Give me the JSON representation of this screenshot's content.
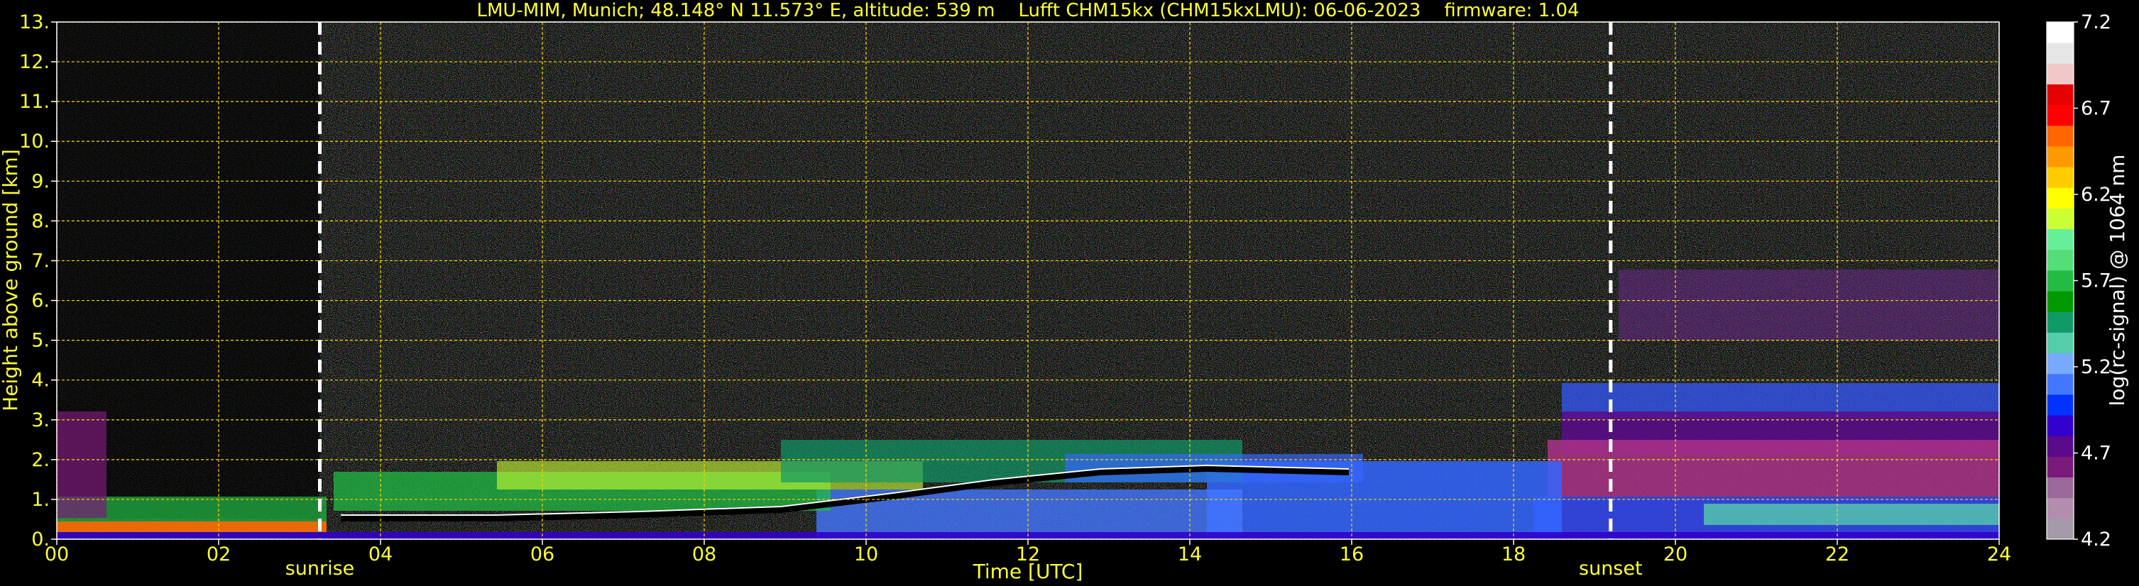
{
  "chart_data": {
    "type": "heatmap",
    "title": "LMU-MIM, Munich; 48.148° N 11.573° E, altitude: 539 m    Lufft CHM15kx (CHM15kxLMU): 06-06-2023    firmware: 1.04",
    "xlabel": "Time [UTC]",
    "ylabel": "Height above ground [km]",
    "xlim": [
      0,
      24
    ],
    "ylim": [
      0,
      13
    ],
    "x_ticks": [
      "00",
      "02",
      "04",
      "06",
      "08",
      "10",
      "12",
      "14",
      "16",
      "18",
      "20",
      "22",
      "24"
    ],
    "y_ticks": [
      "0.",
      "1.",
      "2.",
      "3.",
      "4.",
      "5.",
      "6.",
      "7.",
      "8.",
      "9.",
      "10.",
      "11.",
      "12.",
      "13."
    ],
    "grid": true,
    "grid_color": "#ffd700",
    "markers": [
      {
        "label": "sunrise",
        "time_h": 3.25
      },
      {
        "label": "sunset",
        "time_h": 19.2
      }
    ],
    "colorbar": {
      "label": "log(rc-signal) @ 1064 nm",
      "range": [
        4.2,
        7.2
      ],
      "tick_labels": [
        "7.2",
        "6.7",
        "6.2",
        "5.7",
        "5.2",
        "4.7",
        "4.2"
      ],
      "colors": [
        "#a59aa8",
        "#b38cae",
        "#9a6a9a",
        "#7a1a7a",
        "#5a0a8a",
        "#3300cc",
        "#0033ff",
        "#4477ff",
        "#77aaff",
        "#55ccaa",
        "#119966",
        "#009900",
        "#22bb44",
        "#55dd77",
        "#66ee99",
        "#ccff33",
        "#ffff00",
        "#ffcc00",
        "#ff9900",
        "#ff6600",
        "#ff0000",
        "#e60000",
        "#f0c8c8",
        "#e6e6e6",
        "#ffffff"
      ]
    }
  }
}
